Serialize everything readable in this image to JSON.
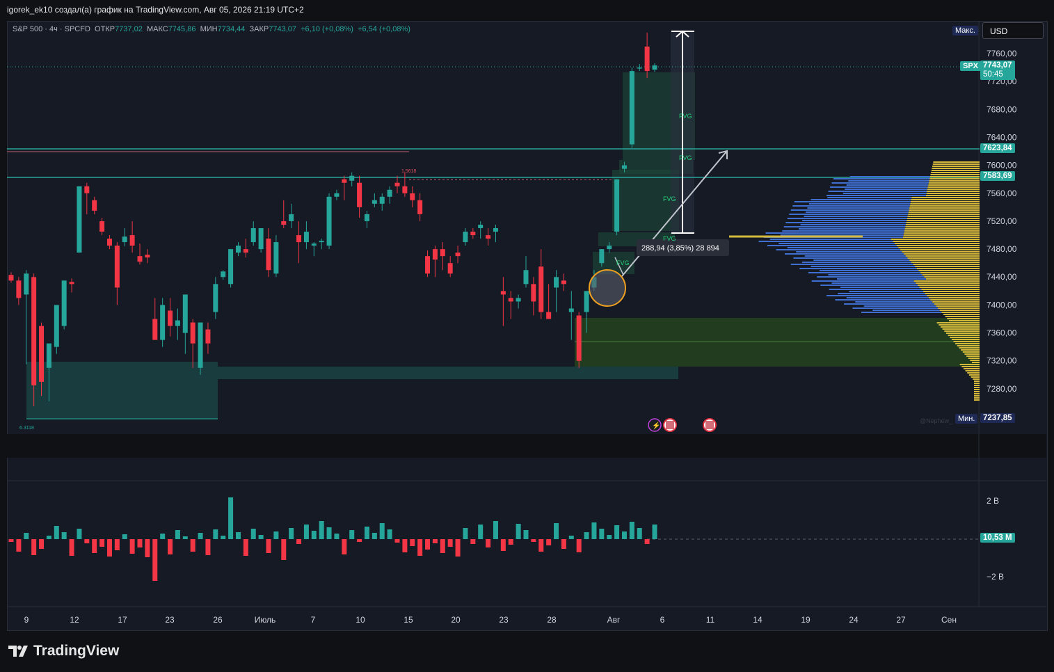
{
  "header": {
    "title": "igorek_ek10 создал(а) график на TradingView.com, Авг 05, 2026 21:19 UTC+2"
  },
  "legend": {
    "symbol": "S&P 500 · 4ч · SPCFD",
    "open_label": "ОТКР",
    "open": "7737,02",
    "high_label": "МАКС",
    "high": "7745,86",
    "low_label": "МИН",
    "low": "7734,44",
    "close_label": "ЗАКР",
    "close": "7743,07",
    "change1": "+6,10 (+0,08%)",
    "change2": "+6,54 (+0,08%)"
  },
  "currency": "USD",
  "price_axis": {
    "ticks": [
      "7760,00",
      "7720,00",
      "7680,00",
      "7640,00",
      "7600,00",
      "7560,00",
      "7520,00",
      "7480,00",
      "7440,00",
      "7400,00",
      "7360,00",
      "7320,00",
      "7280,00"
    ],
    "max_label": "Макс.",
    "min_label": "Мин.",
    "min_value": "7237,85",
    "symbol_tag": "SPX",
    "last_price": "7743,07",
    "countdown": "50:45",
    "level1": "7623,84",
    "level2": "7583,69"
  },
  "volume_axis": {
    "ticks": [
      "2 B",
      "−2 B"
    ],
    "last": "10,53 M"
  },
  "time_axis": [
    "9",
    "12",
    "17",
    "23",
    "26",
    "Июль",
    "7",
    "10",
    "15",
    "20",
    "23",
    "28",
    "Авг",
    "6",
    "11",
    "14",
    "19",
    "24",
    "27",
    "Сен"
  ],
  "annotations": {
    "measure": "288,94 (3,85%) 28 894",
    "fvg": [
      "FVG",
      "FVG",
      "FVG",
      "FVG",
      "FVG"
    ],
    "fib_high": "1.5618",
    "fib_low": "6.3118",
    "watermark": "@Nephew_"
  },
  "brand": "TradingView",
  "colors": {
    "up": "#26a69a",
    "down": "#f23645",
    "bg": "#161a25",
    "level": "#26a69a",
    "profile_blue": "#3f6fd0",
    "profile_yellow": "#d4b93a"
  },
  "chart_data": {
    "type": "candlestick",
    "timeframe": "4h",
    "ylim": [
      7230,
      7790
    ],
    "candles": [
      [
        7443,
        7447,
        7432,
        7435
      ],
      [
        7435,
        7440,
        7400,
        7410
      ],
      [
        7415,
        7450,
        7315,
        7445
      ],
      [
        7440,
        7445,
        7255,
        7285
      ],
      [
        7370,
        7375,
        7270,
        7290
      ],
      [
        7310,
        7335,
        7262,
        7345
      ],
      [
        7340,
        7395,
        7330,
        7400
      ],
      [
        7370,
        7425,
        7365,
        7435
      ],
      [
        7433,
        7438,
        7418,
        7430
      ],
      [
        7475,
        7480,
        7520,
        7570
      ],
      [
        7570,
        7575,
        7530,
        7560
      ],
      [
        7550,
        7555,
        7530,
        7535
      ],
      [
        7520,
        7525,
        7500,
        7505
      ],
      [
        7495,
        7500,
        7480,
        7485
      ],
      [
        7485,
        7490,
        7400,
        7425
      ],
      [
        7490,
        7510,
        7484,
        7498
      ],
      [
        7500,
        7520,
        7475,
        7485
      ],
      [
        7470,
        7488,
        7458,
        7462
      ],
      [
        7472,
        7480,
        7460,
        7468
      ],
      [
        7380,
        7410,
        7365,
        7350
      ],
      [
        7350,
        7410,
        7340,
        7400
      ],
      [
        7392,
        7410,
        7355,
        7370
      ],
      [
        7370,
        7395,
        7350,
        7378
      ],
      [
        7360,
        7410,
        7330,
        7415
      ],
      [
        7375,
        7380,
        7310,
        7345
      ],
      [
        7310,
        7375,
        7300,
        7375
      ],
      [
        7365,
        7375,
        7330,
        7345
      ],
      [
        7390,
        7440,
        7380,
        7430
      ],
      [
        7440,
        7450,
        7436,
        7448
      ],
      [
        7430,
        7480,
        7425,
        7480
      ],
      [
        7475,
        7490,
        7470,
        7485
      ],
      [
        7480,
        7495,
        7468,
        7475
      ],
      [
        7490,
        7520,
        7485,
        7510
      ],
      [
        7480,
        7510,
        7475,
        7510
      ],
      [
        7495,
        7510,
        7440,
        7450
      ],
      [
        7445,
        7500,
        7440,
        7490
      ],
      [
        7520,
        7550,
        7510,
        7515
      ],
      [
        7520,
        7545,
        7510,
        7530
      ],
      [
        7500,
        7520,
        7460,
        7490
      ],
      [
        7490,
        7520,
        7480,
        7505
      ],
      [
        7485,
        7490,
        7470,
        7488
      ],
      [
        7490,
        7495,
        7480,
        7492
      ],
      [
        7485,
        7560,
        7480,
        7555
      ],
      [
        7555,
        7565,
        7550,
        7560
      ],
      [
        7580,
        7585,
        7550,
        7575
      ],
      [
        7578,
        7590,
        7570,
        7585
      ],
      [
        7575,
        7585,
        7525,
        7540
      ],
      [
        7520,
        7535,
        7510,
        7530
      ],
      [
        7545,
        7560,
        7540,
        7550
      ],
      [
        7545,
        7560,
        7535,
        7555
      ],
      [
        7555,
        7570,
        7545,
        7565
      ],
      [
        7575,
        7585,
        7560,
        7570
      ],
      [
        7570,
        7590,
        7555,
        7560
      ],
      [
        7560,
        7570,
        7540,
        7550
      ],
      [
        7550,
        7560,
        7520,
        7530
      ],
      [
        7470,
        7478,
        7440,
        7445
      ],
      [
        7480,
        7485,
        7440,
        7465
      ],
      [
        7480,
        7490,
        7450,
        7470
      ],
      [
        7460,
        7470,
        7440,
        7445
      ],
      [
        7475,
        7485,
        7460,
        7470
      ],
      [
        7490,
        7510,
        7485,
        7505
      ],
      [
        7505,
        7510,
        7495,
        7500
      ],
      [
        7510,
        7520,
        7495,
        7515
      ],
      [
        7500,
        7510,
        7485,
        7495
      ],
      [
        7505,
        7515,
        7490,
        7510
      ],
      [
        7420,
        7440,
        7370,
        7415
      ],
      [
        7410,
        7420,
        7380,
        7405
      ],
      [
        7405,
        7415,
        7395,
        7410
      ],
      [
        7430,
        7470,
        7425,
        7450
      ],
      [
        7430,
        7440,
        7385,
        7405
      ],
      [
        7455,
        7480,
        7380,
        7390
      ],
      [
        7390,
        7430,
        7380,
        7380
      ],
      [
        7425,
        7450,
        7390,
        7440
      ],
      [
        7435,
        7445,
        7420,
        7430
      ],
      [
        7390,
        7420,
        7350,
        7395
      ],
      [
        7385,
        7390,
        7310,
        7320
      ],
      [
        7390,
        7420,
        7360,
        7420
      ],
      [
        7425,
        7450,
        7420,
        7440
      ],
      [
        7460,
        7475,
        7455,
        7480
      ],
      [
        7480,
        7490,
        7475,
        7485
      ],
      [
        7505,
        7580,
        7500,
        7580
      ],
      [
        7595,
        7605,
        7590,
        7600
      ],
      [
        7630,
        7740,
        7625,
        7735
      ],
      [
        7740,
        7745,
        7735,
        7740
      ],
      [
        7770,
        7790,
        7725,
        7735
      ],
      [
        7737,
        7746,
        7734,
        7743
      ]
    ]
  }
}
